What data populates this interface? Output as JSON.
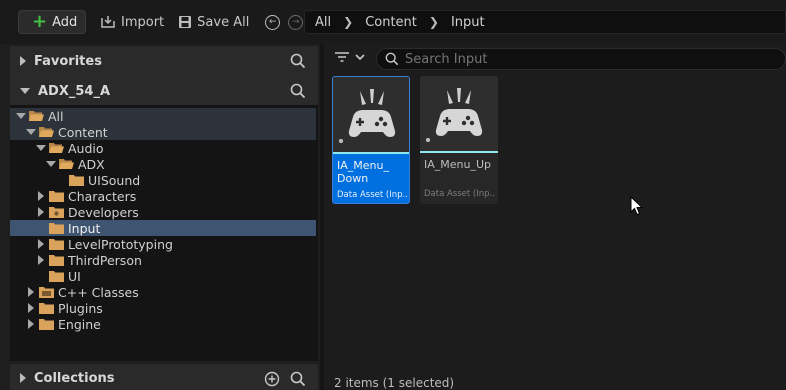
{
  "toolbar": {
    "add_label": "Add",
    "import_label": "Import",
    "saveall_label": "Save All"
  },
  "breadcrumb": [
    "All",
    "Content",
    "Input"
  ],
  "favorites": {
    "title": "Favorites"
  },
  "project": {
    "title": "ADX_54_A"
  },
  "tree": {
    "all": "All",
    "content": "Content",
    "audio": "Audio",
    "adx": "ADX",
    "uisound": "UISound",
    "characters": "Characters",
    "developers": "Developers",
    "input": "Input",
    "levelprototyping": "LevelPrototyping",
    "thirdperson": "ThirdPerson",
    "ui": "UI",
    "cpp": "C++ Classes",
    "plugins": "Plugins",
    "engine": "Engine"
  },
  "collections": {
    "title": "Collections"
  },
  "search": {
    "placeholder": "Search Input"
  },
  "assets": [
    {
      "name": "IA_Menu_\nDown",
      "type": "Data Asset (Inp..."
    },
    {
      "name": "IA_Menu_Up",
      "type": "Data Asset (Inp..."
    }
  ],
  "status": "2 items (1 selected)",
  "colors": {
    "accent": "#0070e0",
    "selected_row": "#3f5470",
    "folder": "#d9a35c",
    "add_green": "#44c144"
  }
}
